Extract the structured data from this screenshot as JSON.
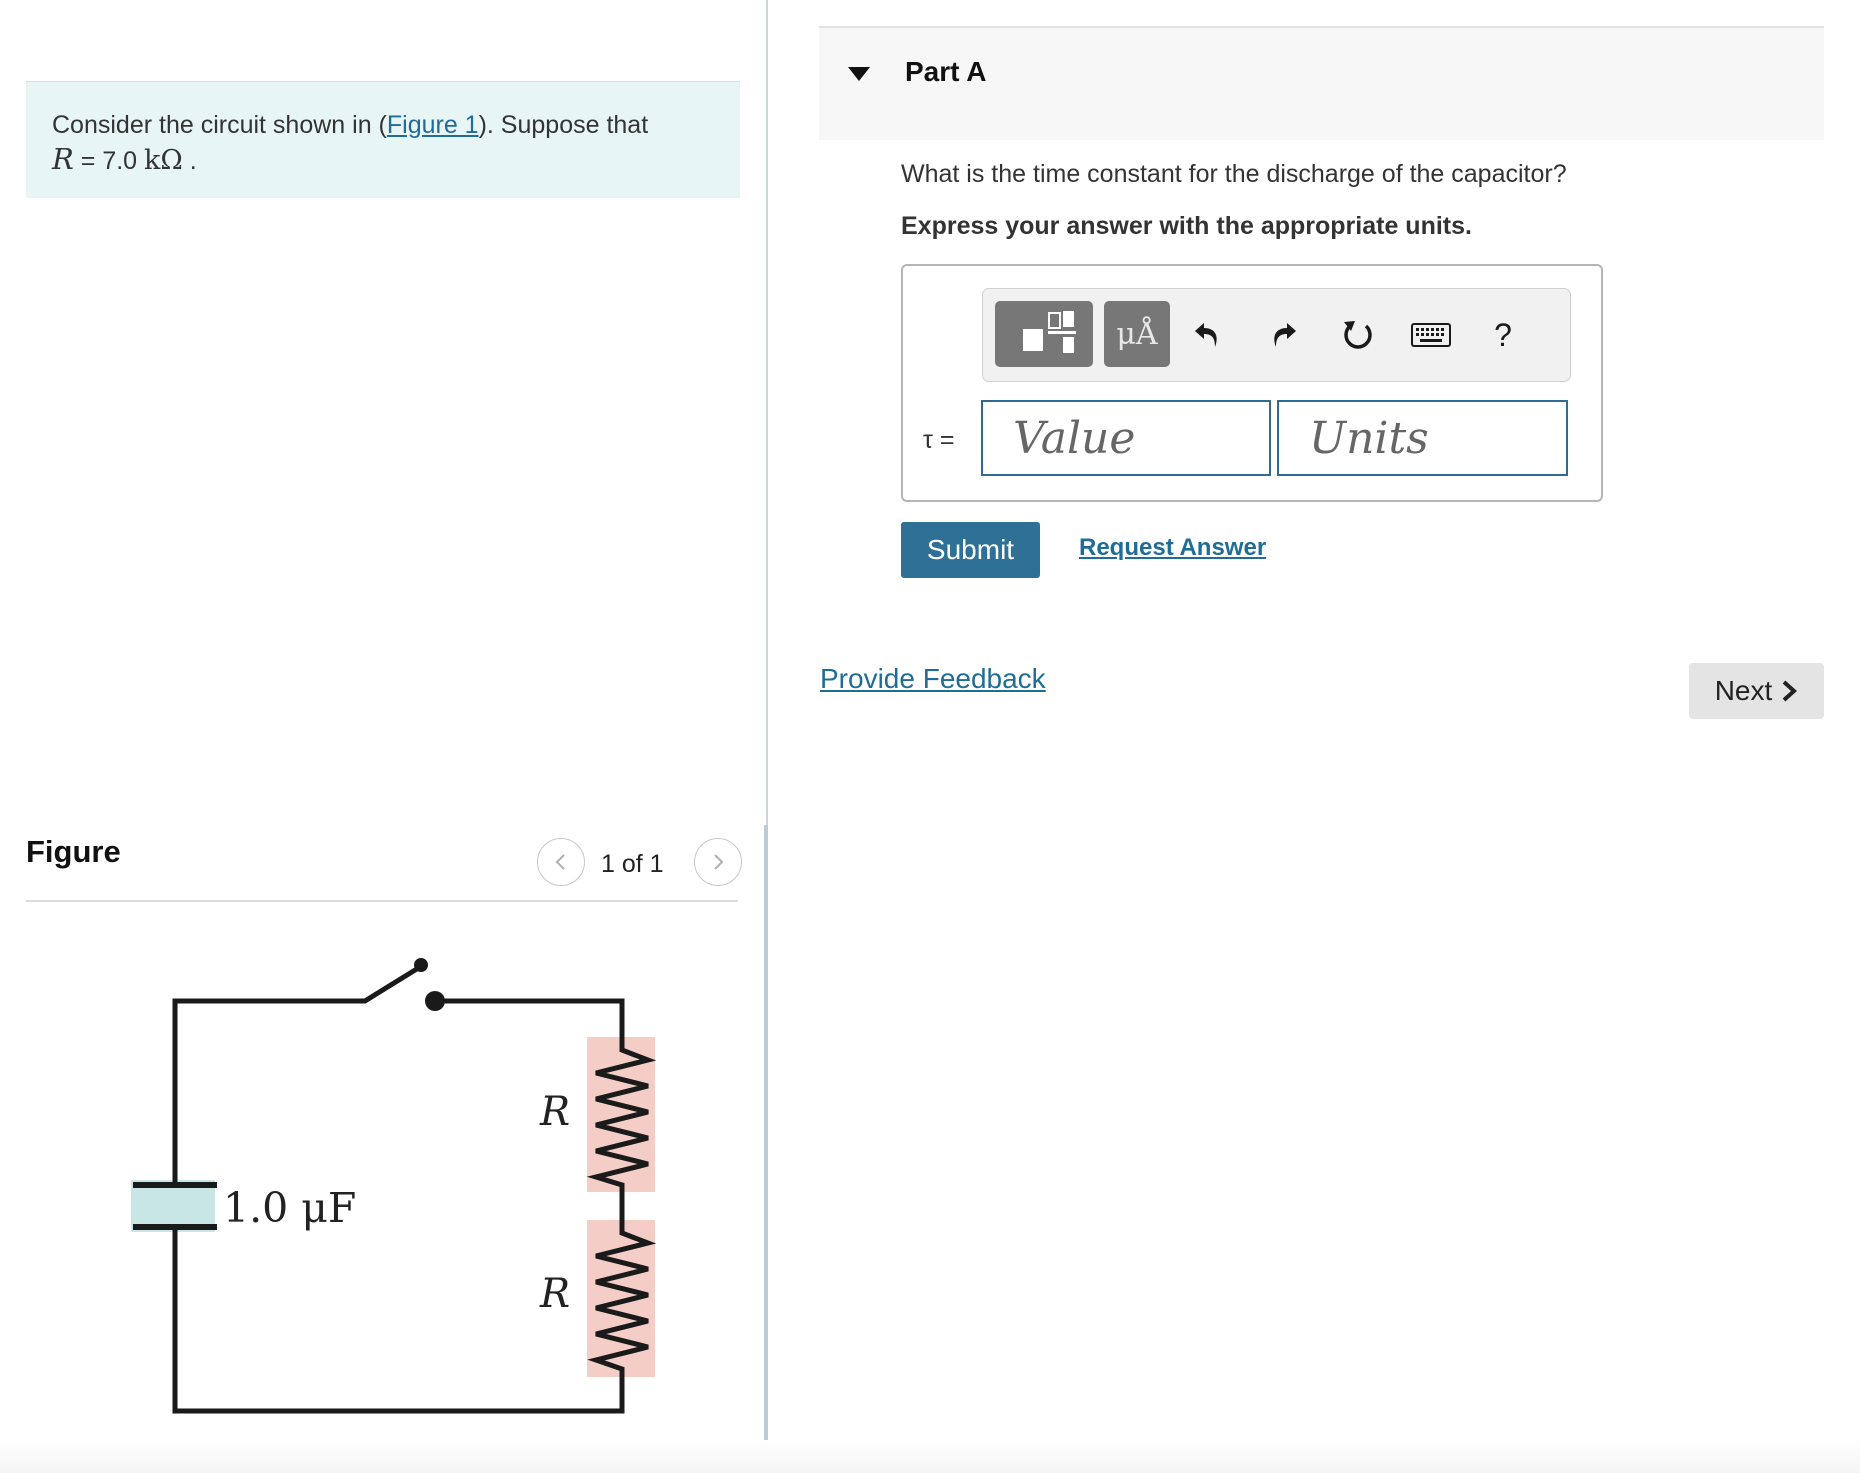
{
  "problem": {
    "text_before": "Consider the circuit shown in (",
    "figure_link": "Figure 1",
    "text_after": "). Suppose that",
    "r_var": "R",
    "r_eq": " = 7.0 ",
    "r_unit": "kΩ",
    "r_end": " ."
  },
  "figure": {
    "heading": "Figure",
    "pager": "1 of 1",
    "capacitor_label": "1.0 μF",
    "resistor_label_top": "R",
    "resistor_label_bottom": "R"
  },
  "part_a": {
    "title": "Part A",
    "question": "What is the time constant for the discharge of the capacitor?",
    "instruction": "Express your answer with the appropriate units.",
    "toolbar": {
      "units_button": "μÅ",
      "help": "?"
    },
    "tau_label": "τ =",
    "value_placeholder": "Value",
    "units_placeholder": "Units",
    "submit": "Submit",
    "request_answer": "Request Answer"
  },
  "footer": {
    "feedback": "Provide Feedback",
    "next": "Next"
  },
  "colors": {
    "accent": "#2e7096",
    "link": "#1f6d97",
    "problem_bg": "#e8f5f5",
    "resistor_highlight": "#f4cdc6",
    "capacitor_highlight": "#c9e6e6"
  }
}
